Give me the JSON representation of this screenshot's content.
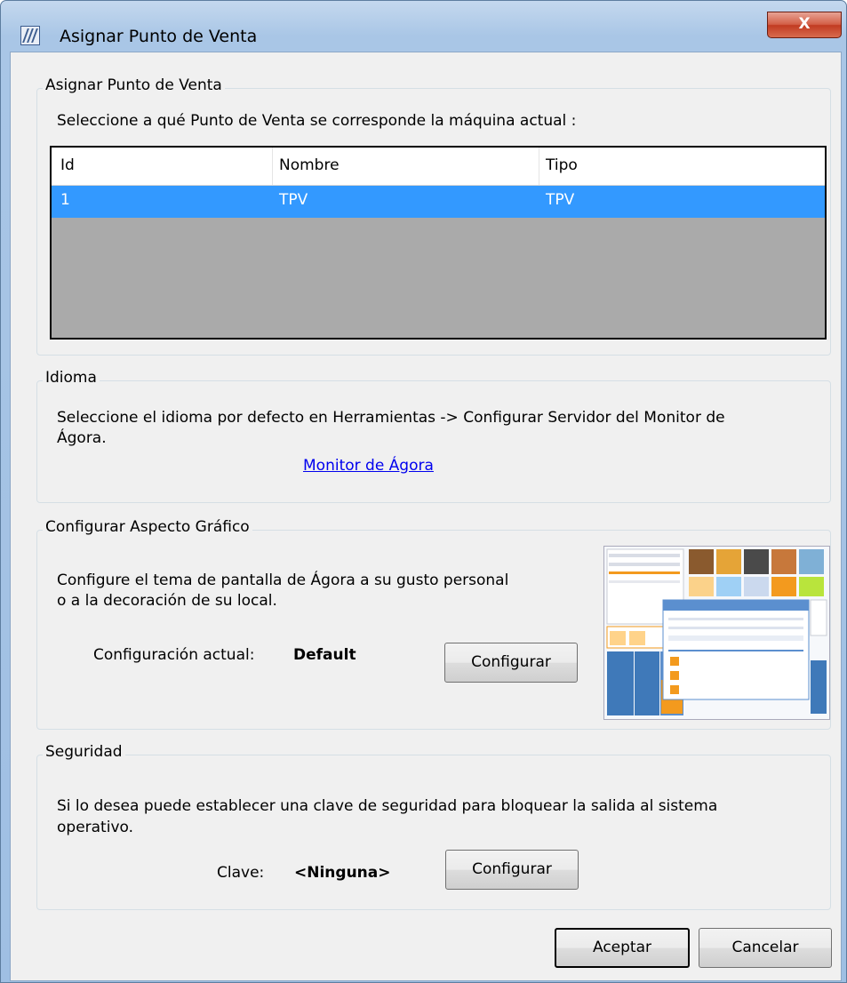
{
  "window": {
    "title": "Asignar Punto de Venta",
    "close_glyph": "X"
  },
  "pos_group": {
    "legend": "Asignar Punto de Venta",
    "instruction": "Seleccione a qué Punto de Venta se corresponde la máquina actual :",
    "columns": [
      "Id",
      "Nombre",
      "Tipo"
    ],
    "rows": [
      {
        "id": "1",
        "nombre": "TPV",
        "tipo": "TPV"
      }
    ]
  },
  "idioma_group": {
    "legend": "Idioma",
    "text_line1": "Seleccione el idioma por defecto en Herramientas -> Configurar Servidor del Monitor de",
    "text_line2": "Ágora.",
    "link": "Monitor de Ágora"
  },
  "aspecto_group": {
    "legend": "Configurar Aspecto Gráfico",
    "text_line1": "Configure el tema de pantalla de Ágora a su gusto personal",
    "text_line2": "o a la decoración de su local.",
    "current_label": "Configuración actual:",
    "current_value": "Default",
    "button": "Configurar",
    "colors": {
      "orange": "#f39a1e",
      "blue": "#3f79b9",
      "header_blue": "#5b8fcf"
    }
  },
  "seguridad_group": {
    "legend": "Seguridad",
    "text_line1": "Si lo desea puede establecer una clave de seguridad para bloquear la salida al sistema",
    "text_line2": "operativo.",
    "key_label": "Clave:",
    "key_value": "<Ninguna>",
    "button": "Configurar"
  },
  "footer": {
    "accept": "Aceptar",
    "cancel": "Cancelar"
  },
  "colors": {
    "selection": "#3399ff",
    "grid_empty": "#aaaaaa",
    "dialog_bg": "#f0f0f0",
    "link": "#0000ee"
  }
}
